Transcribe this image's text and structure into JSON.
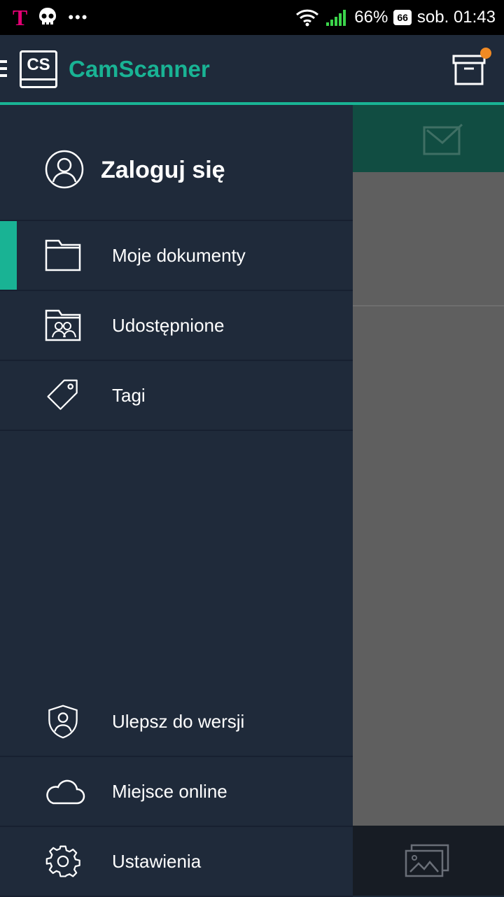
{
  "status_bar": {
    "carrier_logo": "T",
    "more_dots": "•••",
    "battery_percent": "66%",
    "battery_level": "66",
    "datetime": "sob. 01:43",
    "icons": [
      "skull-icon",
      "wifi-icon",
      "signal-icon",
      "battery-icon"
    ]
  },
  "header": {
    "logo_text": "CS",
    "app_name": "CamScanner",
    "accent_color": "#19b394",
    "notification_color": "#f08a24"
  },
  "drawer": {
    "login_label": "Zaloguj się",
    "top_items": [
      {
        "label": "Moje dokumenty",
        "icon": "folder-icon",
        "active": true
      },
      {
        "label": "Udostępnione",
        "icon": "shared-folder-icon",
        "active": false
      },
      {
        "label": "Tagi",
        "icon": "tag-icon",
        "active": false
      }
    ],
    "bottom_items": [
      {
        "label": "Ulepsz do wersji",
        "icon": "shield-user-icon"
      },
      {
        "label": "Miejsce online",
        "icon": "cloud-icon"
      },
      {
        "label": "Ustawienia",
        "icon": "gear-icon"
      }
    ]
  }
}
